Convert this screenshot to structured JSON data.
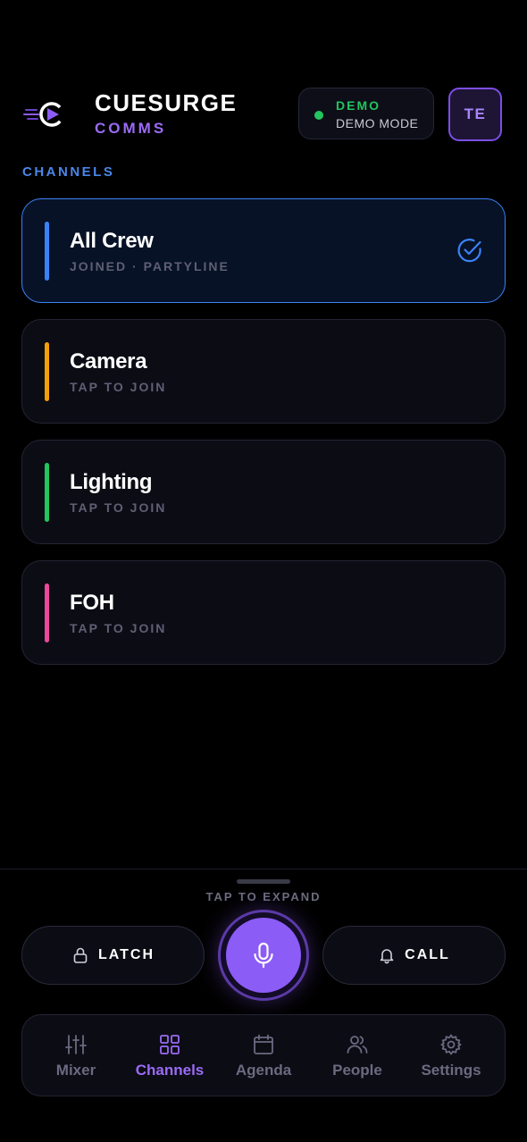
{
  "header": {
    "brand_title": "CUESURGE",
    "brand_subtitle": "COMMS",
    "demo_label": "DEMO",
    "demo_mode": "DEMO MODE",
    "avatar_initials": "TE"
  },
  "channels_section": {
    "label": "CHANNELS",
    "items": [
      {
        "name": "All Crew",
        "status": "JOINED · PARTYLINE",
        "color": "#3b82f6",
        "joined": true
      },
      {
        "name": "Camera",
        "status": "TAP TO JOIN",
        "color": "#f59e0b",
        "joined": false
      },
      {
        "name": "Lighting",
        "status": "TAP TO JOIN",
        "color": "#22c55e",
        "joined": false
      },
      {
        "name": "FOH",
        "status": "TAP TO JOIN",
        "color": "#ec4899",
        "joined": false
      }
    ]
  },
  "controls": {
    "expand_label": "TAP TO EXPAND",
    "latch_label": "LATCH",
    "call_label": "CALL",
    "latch_icon": "lock-icon",
    "call_icon": "bell-icon",
    "talk_icon": "microphone-icon"
  },
  "nav": {
    "items": [
      {
        "label": "Mixer",
        "icon": "sliders-icon",
        "active": false
      },
      {
        "label": "Channels",
        "icon": "grid-icon",
        "active": true
      },
      {
        "label": "Agenda",
        "icon": "calendar-icon",
        "active": false
      },
      {
        "label": "People",
        "icon": "people-icon",
        "active": false
      },
      {
        "label": "Settings",
        "icon": "gear-icon",
        "active": false
      }
    ]
  },
  "colors": {
    "accent": "#8b5cf6",
    "active_channel": "#3b82f6",
    "demo_green": "#22c55e"
  }
}
